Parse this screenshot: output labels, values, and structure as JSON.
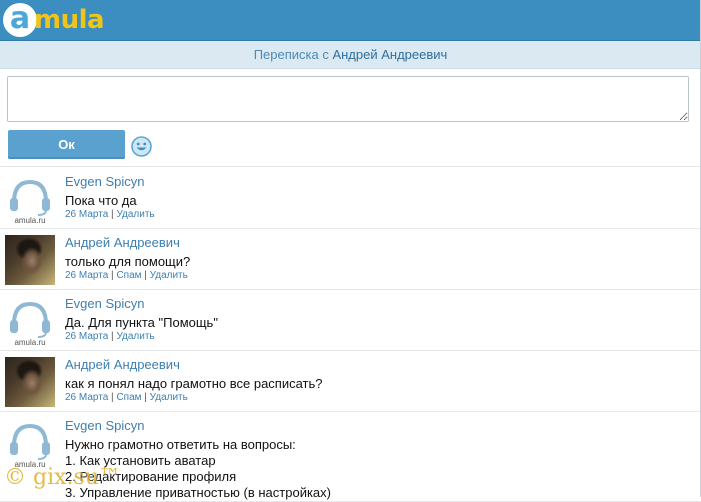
{
  "brand": {
    "logo_letter": "a",
    "logo_rest": "mula"
  },
  "header": {
    "prefix": "Переписка с ",
    "contact_name": "Андрей Андреевич"
  },
  "composer": {
    "value": "",
    "placeholder": "",
    "ok_label": "Ок"
  },
  "avatar_caption": "amula.ru",
  "colors": {
    "topbar": "#3d8ec0",
    "subheader": "#dbe9f2",
    "link": "#3d7fb0",
    "button": "#5ba1cf",
    "logo_yellow": "#f0c419"
  },
  "messages": [
    {
      "author": "Evgen Spicyn",
      "avatar": "default-headset",
      "lines": [
        "Пока что да"
      ],
      "date": "26 Марта",
      "actions": [
        "Удалить"
      ]
    },
    {
      "author": "Андрей Андреевич",
      "avatar": "photo",
      "lines": [
        "только для помощи?"
      ],
      "date": "26 Марта",
      "actions": [
        "Спам",
        "Удалить"
      ]
    },
    {
      "author": "Evgen Spicyn",
      "avatar": "default-headset",
      "lines": [
        "Да. Для пункта \"Помощь\""
      ],
      "date": "26 Марта",
      "actions": [
        "Удалить"
      ]
    },
    {
      "author": "Андрей Андреевич",
      "avatar": "photo",
      "lines": [
        "как я понял надо грамотно все расписать?"
      ],
      "date": "26 Марта",
      "actions": [
        "Спам",
        "Удалить"
      ]
    },
    {
      "author": "Evgen Spicyn",
      "avatar": "default-headset",
      "lines": [
        "Нужно грамотно ответить на вопросы:",
        "1. Как установить аватар",
        "2. Редактирование профиля",
        "3. Управление приватностью (в настройках)"
      ],
      "date": "",
      "actions": []
    }
  ],
  "watermark": "© gix.su™"
}
